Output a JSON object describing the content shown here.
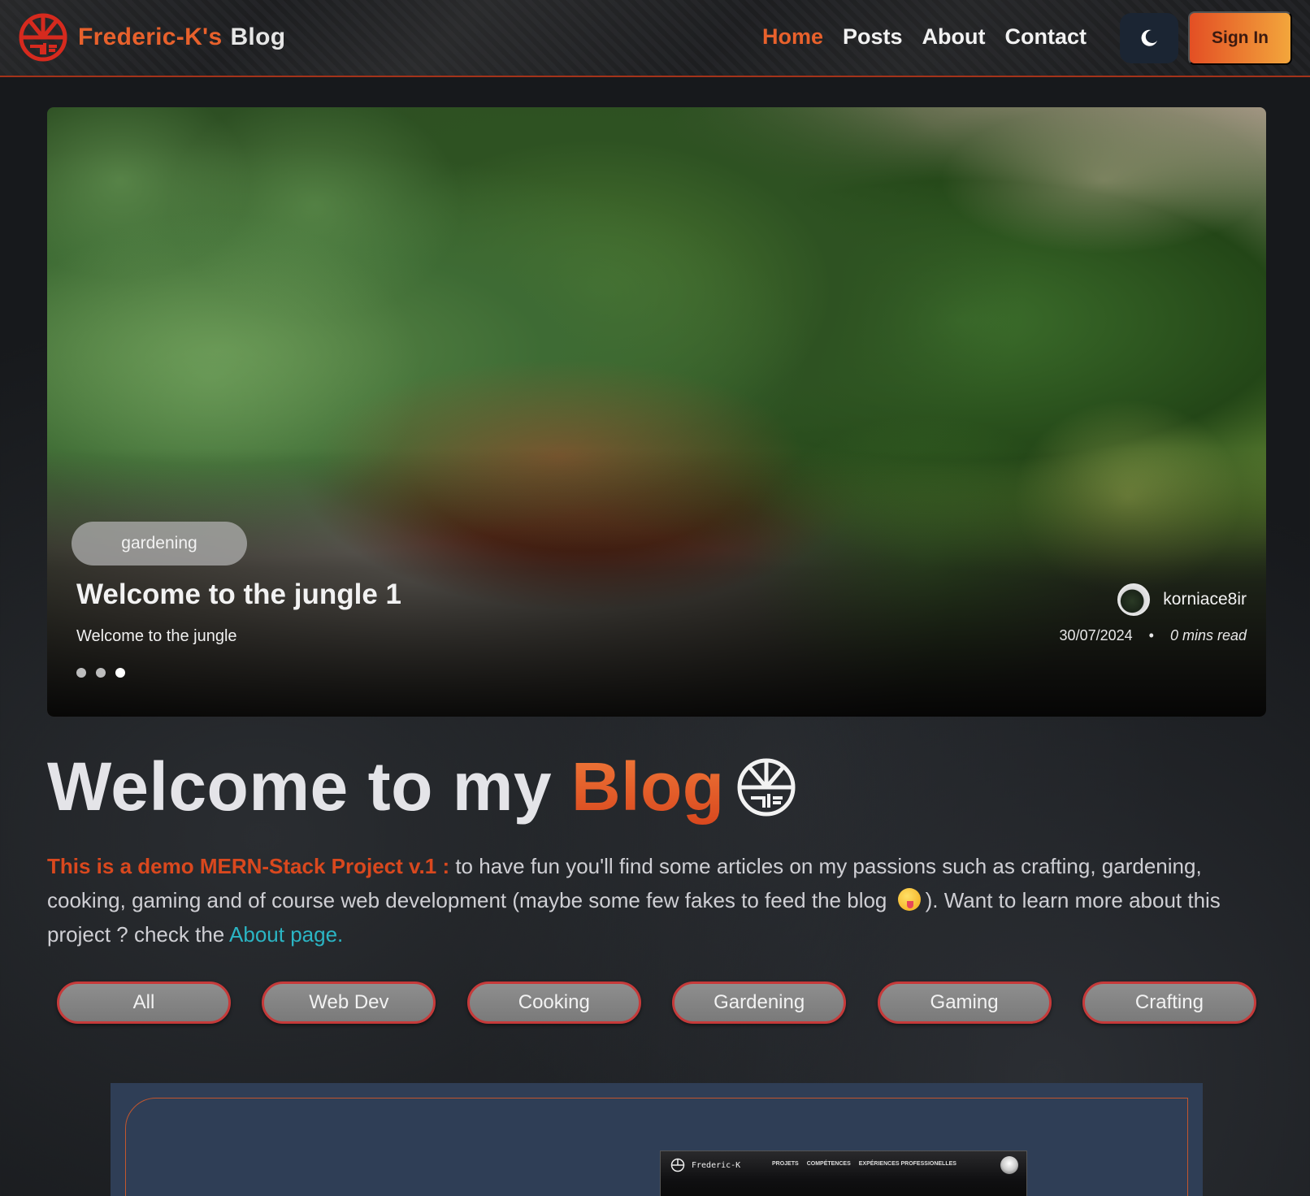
{
  "navbar": {
    "brand_name": "Frederic-K's",
    "brand_suffix": "Blog",
    "links": [
      {
        "label": "Home",
        "active": true
      },
      {
        "label": "Posts",
        "active": false
      },
      {
        "label": "About",
        "active": false
      },
      {
        "label": "Contact",
        "active": false
      }
    ],
    "theme_toggle_icon": "moon-icon",
    "signin_label": "Sign In"
  },
  "hero": {
    "tag": "gardening",
    "title": "Welcome to the jungle 1",
    "subtitle": "Welcome to the jungle",
    "author": "korniace8ir",
    "date": "30/07/2024",
    "separator": "•",
    "read_time": "0 mins read",
    "slides": 3,
    "active_slide": 3
  },
  "welcome": {
    "heading_start": "Welcome to my",
    "heading_accent": "Blog"
  },
  "intro": {
    "highlight": "This is a demo MERN-Stack Project v.1 :",
    "text_1": " to have fun you'll find some articles on my passions such as crafting, gardening, cooking, gaming and of course web development (maybe some few fakes to feed the blog ",
    "text_2": "). Want to learn more about this project ? check the ",
    "link": "About page."
  },
  "categories": [
    "All",
    "Web Dev",
    "Cooking",
    "Gardening",
    "Gaming",
    "Crafting"
  ],
  "preview": {
    "brand": "Frederic-K",
    "nav": [
      "PROJETS",
      "COMPÉTENCES",
      "EXPÉRIENCES PROFESSIONELLES"
    ]
  },
  "colors": {
    "accent": "#e8612c",
    "accent_dark": "#d9481e",
    "link": "#2bb5c4",
    "category_border": "#c63a3a",
    "card_bg": "#2f3e56"
  }
}
